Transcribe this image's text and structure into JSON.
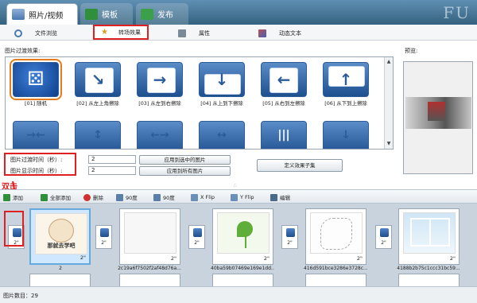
{
  "top_tabs": [
    {
      "label": "照片/视频",
      "active": true
    },
    {
      "label": "模板",
      "active": false
    },
    {
      "label": "发布",
      "active": false
    }
  ],
  "brand": "FU",
  "sub_tabs": [
    {
      "label": "文件浏览",
      "icon": "search-icon"
    },
    {
      "label": "转场效果",
      "icon": "star-wand-icon",
      "active": true
    },
    {
      "label": "属性",
      "icon": "printer-icon"
    },
    {
      "label": "动态文本",
      "icon": "text-brush-icon"
    }
  ],
  "effects_panel": {
    "label": "图片过渡效果:",
    "effects": [
      {
        "caption": "[01] 随机",
        "glyph": "⚄"
      },
      {
        "caption": "[02] 从左上角擦除",
        "glyph": "↘"
      },
      {
        "caption": "[03] 从左到右擦除",
        "glyph": "→"
      },
      {
        "caption": "[04] 从上到下擦除",
        "glyph": "↓"
      },
      {
        "caption": "[05] 从右到左擦除",
        "glyph": "←"
      },
      {
        "caption": "[06] 从下到上擦除",
        "glyph": "↑"
      }
    ],
    "effects_row2": [
      "→←",
      "↕",
      "←→",
      "↔",
      "|||",
      "↓"
    ]
  },
  "preview_label": "预览:",
  "timing": {
    "transition_label": "图片过渡时间（秒）:",
    "transition_value": "2",
    "display_label": "图片显示时间（秒）:",
    "display_value": "2",
    "apply_selected": "应用到选中的图片",
    "apply_all": "应用到所有图片",
    "custom_subset": "定义效果子集"
  },
  "annotation": "双击",
  "splitter_grip": "∴",
  "toolbar": {
    "add": "添加",
    "add_all": "全部添加",
    "delete": "删除",
    "rotate_left": "90度",
    "rotate_right": "90度",
    "xflip": "X Flip",
    "yflip": "Y Flip",
    "edit": "编辑"
  },
  "timeline": {
    "transition_duration": "2\"",
    "frames": [
      {
        "duration": "2\"",
        "name": "2",
        "kind": "cartoon",
        "overlay": "那就去学吧",
        "selected": true
      },
      {
        "duration": "2\"",
        "name": "2c19a6f7502f2af48d76a...",
        "kind": "blank",
        "selected": false
      },
      {
        "duration": "2\"",
        "name": "40ba59b07469e169e1dd...",
        "kind": "clover",
        "selected": false
      },
      {
        "duration": "2\"",
        "name": "416d591bce3286e3728c...",
        "kind": "sketch",
        "selected": false
      },
      {
        "duration": "2\"",
        "name": "4188b2b75c1ccc31bc59...",
        "kind": "window",
        "selected": false
      }
    ]
  },
  "status": "图片数目：29",
  "colors": {
    "accent_red": "#e02020",
    "tab_blue": "#34627f",
    "selected_orange": "#e47d20"
  }
}
